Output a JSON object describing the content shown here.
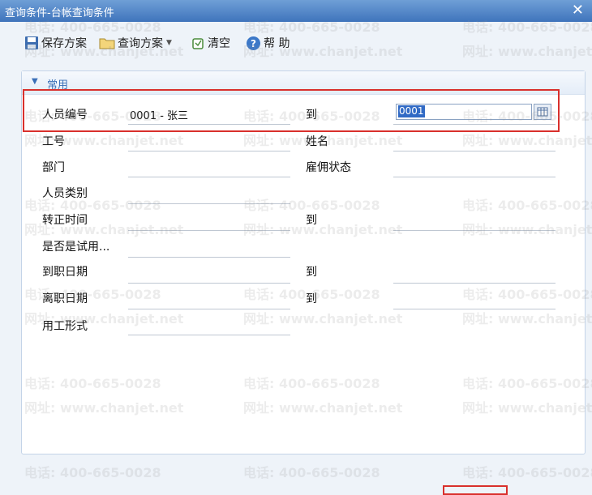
{
  "window": {
    "title": "查询条件-台帐查询条件"
  },
  "toolbar": {
    "save_scheme": "保存方案",
    "query_scheme": "查询方案",
    "clear": "清空",
    "help": "帮 助"
  },
  "panel": {
    "title": "常用"
  },
  "fields": {
    "emp_no": {
      "label": "人员编号",
      "from_value": "0001 - 张三",
      "to_label": "到",
      "to_value": "0001"
    },
    "job_no": {
      "label": "工号"
    },
    "name": {
      "label": "姓名"
    },
    "dept": {
      "label": "部门"
    },
    "employ_status": {
      "label": "雇佣状态"
    },
    "emp_category": {
      "label": "人员类别"
    },
    "confirm_date": {
      "label": "转正时间",
      "to_label": "到"
    },
    "on_trial": {
      "label": "是否是试用..."
    },
    "hire_date": {
      "label": "到职日期",
      "to_label": "到"
    },
    "leave_date": {
      "label": "离职日期",
      "to_label": "到"
    },
    "employ_form": {
      "label": "用工形式"
    }
  },
  "watermark": {
    "phone": "电话: 400-665-0028",
    "site": "网址: www.chanjet.net"
  },
  "colors": {
    "titlebar": "#4a7fc4",
    "highlight": "#d9302c",
    "selection": "#316ac5"
  }
}
